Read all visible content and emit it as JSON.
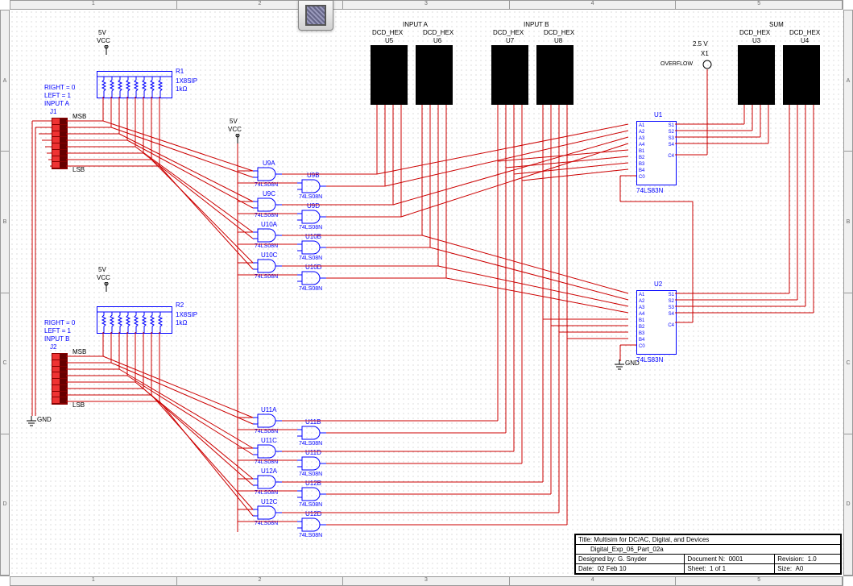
{
  "power": {
    "vcc5_label": "5V",
    "vcc_text": "VCC",
    "probe_v": "2.5 V",
    "probe_ref": "X1",
    "overflow": "OVERFLOW",
    "gnd": "GND"
  },
  "inputs": {
    "a_title": "INPUT A",
    "b_title": "INPUT B",
    "right0": "RIGHT = 0",
    "left1": "LEFT = 1",
    "j1": "J1",
    "j2": "J2",
    "msb": "MSB",
    "lsb": "LSB"
  },
  "resnets": {
    "r1": "R1",
    "r2": "R2",
    "type": "1X8SIP",
    "value": "1kΩ"
  },
  "displays": {
    "sum_title": "SUM",
    "dcd_hex": "DCD_HEX",
    "u5": "U5",
    "u6": "U6",
    "u7": "U7",
    "u8": "U8",
    "u3": "U3",
    "u4": "U4"
  },
  "adders": {
    "u1": "U1",
    "u2": "U2",
    "part": "74LS83N"
  },
  "gates": {
    "part": "74LS08N",
    "u9a": "U9A",
    "u9b": "U9B",
    "u9c": "U9C",
    "u9d": "U9D",
    "u10a": "U10A",
    "u10b": "U10B",
    "u10c": "U10C",
    "u10d": "U10D",
    "u11a": "U11A",
    "u11b": "U11B",
    "u11c": "U11C",
    "u11d": "U11D",
    "u12a": "U12A",
    "u12b": "U12B",
    "u12c": "U12C",
    "u12d": "U12D"
  },
  "chip_pins": {
    "left": [
      "A1",
      "A2",
      "A3",
      "A4",
      "B1",
      "B2",
      "B3",
      "B4",
      "C0"
    ],
    "right": [
      "S1",
      "S2",
      "S3",
      "S4",
      "C4"
    ]
  },
  "titleblock": {
    "title_lbl": "Title:",
    "title": "Multisim for DC/AC, Digital, and Devices",
    "subtitle": "Digital_Exp_06_Part_02a",
    "design_lbl": "Designed by:",
    "designer": "G. Snyder",
    "docn_lbl": "Document N:",
    "docn": "0001",
    "rev_lbl": "Revision:",
    "rev": "1.0",
    "date_lbl": "Date:",
    "date": "02 Feb 10",
    "sheet_lbl": "Sheet:",
    "sheet": "1   of   1",
    "size_lbl": "Size:",
    "size": "A0"
  },
  "ruler_top": [
    "1",
    "2",
    "3",
    "4",
    "5"
  ],
  "ruler_side": [
    "A",
    "B",
    "C",
    "D"
  ]
}
